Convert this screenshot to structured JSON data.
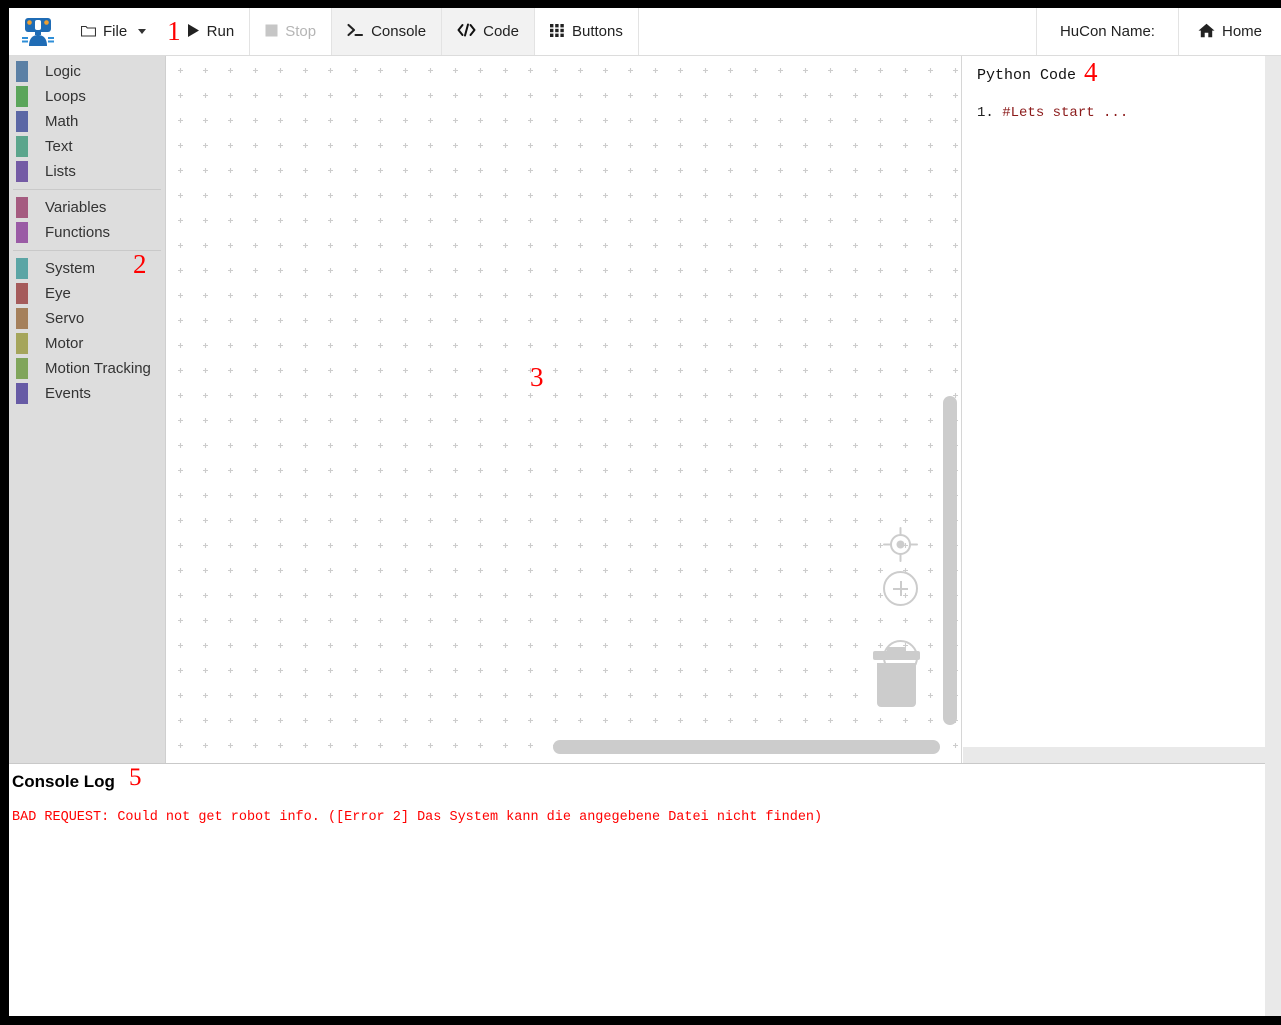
{
  "app": {
    "logo_icon": "robot-logo-icon"
  },
  "toolbar": {
    "file": {
      "label": "File",
      "icon": "folder-icon",
      "caret": "chevron-down-icon"
    },
    "marker_1": "1",
    "run": {
      "label": "Run",
      "icon": "play-icon"
    },
    "stop": {
      "label": "Stop",
      "icon": "stop-square-icon",
      "state": "disabled"
    },
    "console": {
      "label": "Console",
      "icon": "terminal-prompt-icon"
    },
    "code": {
      "label": "Code",
      "icon": "code-brackets-icon"
    },
    "buttons": {
      "label": "Buttons",
      "icon": "grid-dots-icon"
    },
    "hucon_name": {
      "label": "HuCon Name:"
    },
    "home": {
      "label": "Home",
      "icon": "house-icon"
    }
  },
  "toolbox": {
    "marker_2": "2",
    "groups": [
      {
        "items": [
          {
            "label": "Logic",
            "color": "#5b80a5"
          },
          {
            "label": "Loops",
            "color": "#5ba55b"
          },
          {
            "label": "Math",
            "color": "#5b67a5"
          },
          {
            "label": "Text",
            "color": "#5ba58c"
          },
          {
            "label": "Lists",
            "color": "#745ba5"
          }
        ]
      },
      {
        "items": [
          {
            "label": "Variables",
            "color": "#a55b80"
          },
          {
            "label": "Functions",
            "color": "#9a5ba5"
          }
        ]
      },
      {
        "items": [
          {
            "label": "System",
            "color": "#5ba5a5"
          },
          {
            "label": "Eye",
            "color": "#a55b5b"
          },
          {
            "label": "Servo",
            "color": "#a5805b"
          },
          {
            "label": "Motor",
            "color": "#a5a55b"
          },
          {
            "label": "Motion Tracking",
            "color": "#80a55b"
          },
          {
            "label": "Events",
            "color": "#675ba5"
          }
        ]
      }
    ]
  },
  "workspace": {
    "marker_3": "3",
    "controls": {
      "center": "center-target-icon",
      "zoom_in": "zoom-in-icon",
      "zoom_out": "zoom-out-icon",
      "trash": "trash-can-icon"
    },
    "grid": {
      "spacing_px": 25,
      "dot_color": "#cccccc"
    }
  },
  "code_panel": {
    "title": "Python Code",
    "marker_4": "4",
    "lines": [
      {
        "number": "1.",
        "text": "#Lets start ...",
        "color": "#8b1a1a"
      }
    ]
  },
  "console": {
    "title": "Console Log",
    "marker_5": "5",
    "lines": [
      "BAD REQUEST: Could not get robot info. ([Error 2] Das System kann die angegebene Datei nicht finden)"
    ],
    "text_color": "#ff0000"
  }
}
